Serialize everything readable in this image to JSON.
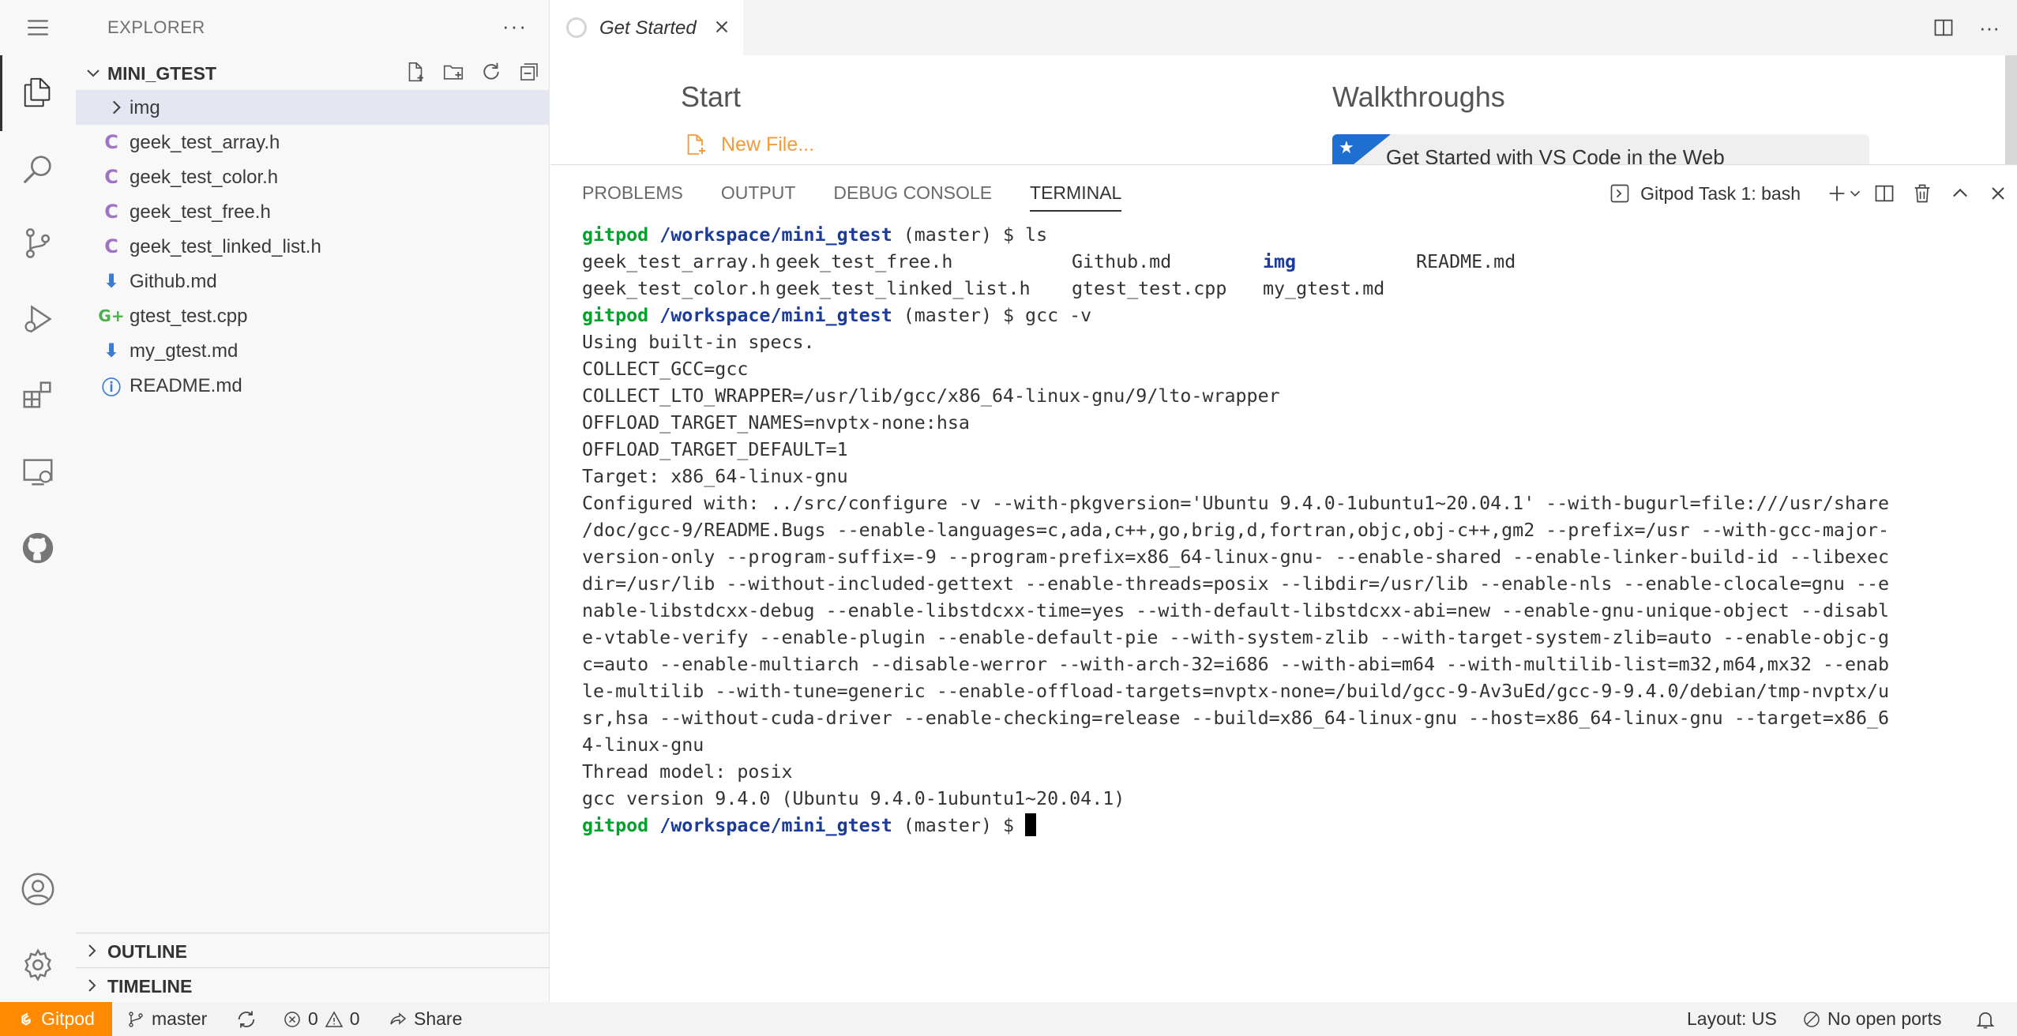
{
  "sidebar": {
    "title": "EXPLORER",
    "more": "···",
    "folder": "MINI_GTEST",
    "items": [
      {
        "label": "img",
        "type": "folder",
        "icon": "chevron-right-icon"
      },
      {
        "label": "geek_test_array.h",
        "type": "c-header",
        "icon": "c-file-icon",
        "glyph": "C"
      },
      {
        "label": "geek_test_color.h",
        "type": "c-header",
        "icon": "c-file-icon",
        "glyph": "C"
      },
      {
        "label": "geek_test_free.h",
        "type": "c-header",
        "icon": "c-file-icon",
        "glyph": "C"
      },
      {
        "label": "geek_test_linked_list.h",
        "type": "c-header",
        "icon": "c-file-icon",
        "glyph": "C"
      },
      {
        "label": "Github.md",
        "type": "markdown",
        "icon": "markdown-download-icon",
        "glyph": "⬇"
      },
      {
        "label": "gtest_test.cpp",
        "type": "cpp",
        "icon": "cpp-file-icon",
        "glyph": "G+"
      },
      {
        "label": "my_gtest.md",
        "type": "markdown",
        "icon": "markdown-download-icon",
        "glyph": "⬇"
      },
      {
        "label": "README.md",
        "type": "readme",
        "icon": "info-icon",
        "glyph": "ⓘ"
      }
    ],
    "outline": "OUTLINE",
    "timeline": "TIMELINE"
  },
  "editor": {
    "tab_title": "Get Started",
    "start_heading": "Start",
    "new_file": "New File...",
    "walkthroughs_heading": "Walkthroughs",
    "walkthrough_card": "Get Started with VS Code in the Web"
  },
  "panel": {
    "tabs": [
      "PROBLEMS",
      "OUTPUT",
      "DEBUG CONSOLE",
      "TERMINAL"
    ],
    "active_tab": "TERMINAL",
    "terminal_name": "Gitpod Task 1: bash",
    "prompt": {
      "user": "gitpod",
      "path": "/workspace/mini_gtest",
      "branch": " (master) $ "
    },
    "cmd1": "ls",
    "ls_row1": [
      "geek_test_array.h",
      "geek_test_free.h",
      "Github.md",
      "img",
      "README.md"
    ],
    "ls_row2": [
      "geek_test_color.h",
      "geek_test_linked_list.h",
      "gtest_test.cpp",
      "my_gtest.md"
    ],
    "cmd2": "gcc -v",
    "gcc_output": [
      "Using built-in specs.",
      "COLLECT_GCC=gcc",
      "COLLECT_LTO_WRAPPER=/usr/lib/gcc/x86_64-linux-gnu/9/lto-wrapper",
      "OFFLOAD_TARGET_NAMES=nvptx-none:hsa",
      "OFFLOAD_TARGET_DEFAULT=1",
      "Target: x86_64-linux-gnu",
      "Configured with: ../src/configure -v --with-pkgversion='Ubuntu 9.4.0-1ubuntu1~20.04.1' --with-bugurl=file:///usr/share",
      "/doc/gcc-9/README.Bugs --enable-languages=c,ada,c++,go,brig,d,fortran,objc,obj-c++,gm2 --prefix=/usr --with-gcc-major-",
      "version-only --program-suffix=-9 --program-prefix=x86_64-linux-gnu- --enable-shared --enable-linker-build-id --libexec",
      "dir=/usr/lib --without-included-gettext --enable-threads=posix --libdir=/usr/lib --enable-nls --enable-clocale=gnu --e",
      "nable-libstdcxx-debug --enable-libstdcxx-time=yes --with-default-libstdcxx-abi=new --enable-gnu-unique-object --disabl",
      "e-vtable-verify --enable-plugin --enable-default-pie --with-system-zlib --with-target-system-zlib=auto --enable-objc-g",
      "c=auto --enable-multiarch --disable-werror --with-arch-32=i686 --with-abi=m64 --with-multilib-list=m32,m64,mx32 --enab",
      "le-multilib --with-tune=generic --enable-offload-targets=nvptx-none=/build/gcc-9-Av3uEd/gcc-9-9.4.0/debian/tmp-nvptx/u",
      "sr,hsa --without-cuda-driver --enable-checking=release --build=x86_64-linux-gnu --host=x86_64-linux-gnu --target=x86_6",
      "4-linux-gnu",
      "Thread model: posix",
      "gcc version 9.4.0 (Ubuntu 9.4.0-1ubuntu1~20.04.1)"
    ]
  },
  "status": {
    "remote": "Gitpod",
    "branch": "master",
    "errors": "0",
    "warnings": "0",
    "share": "Share",
    "layout": "Layout: US",
    "ports": "No open ports"
  },
  "colors": {
    "accent": "#ff8a00",
    "prompt_user": "#00a32a",
    "prompt_path": "#1a3b9c",
    "c_icon": "#a074c4",
    "md_icon": "#3c7bd1"
  }
}
